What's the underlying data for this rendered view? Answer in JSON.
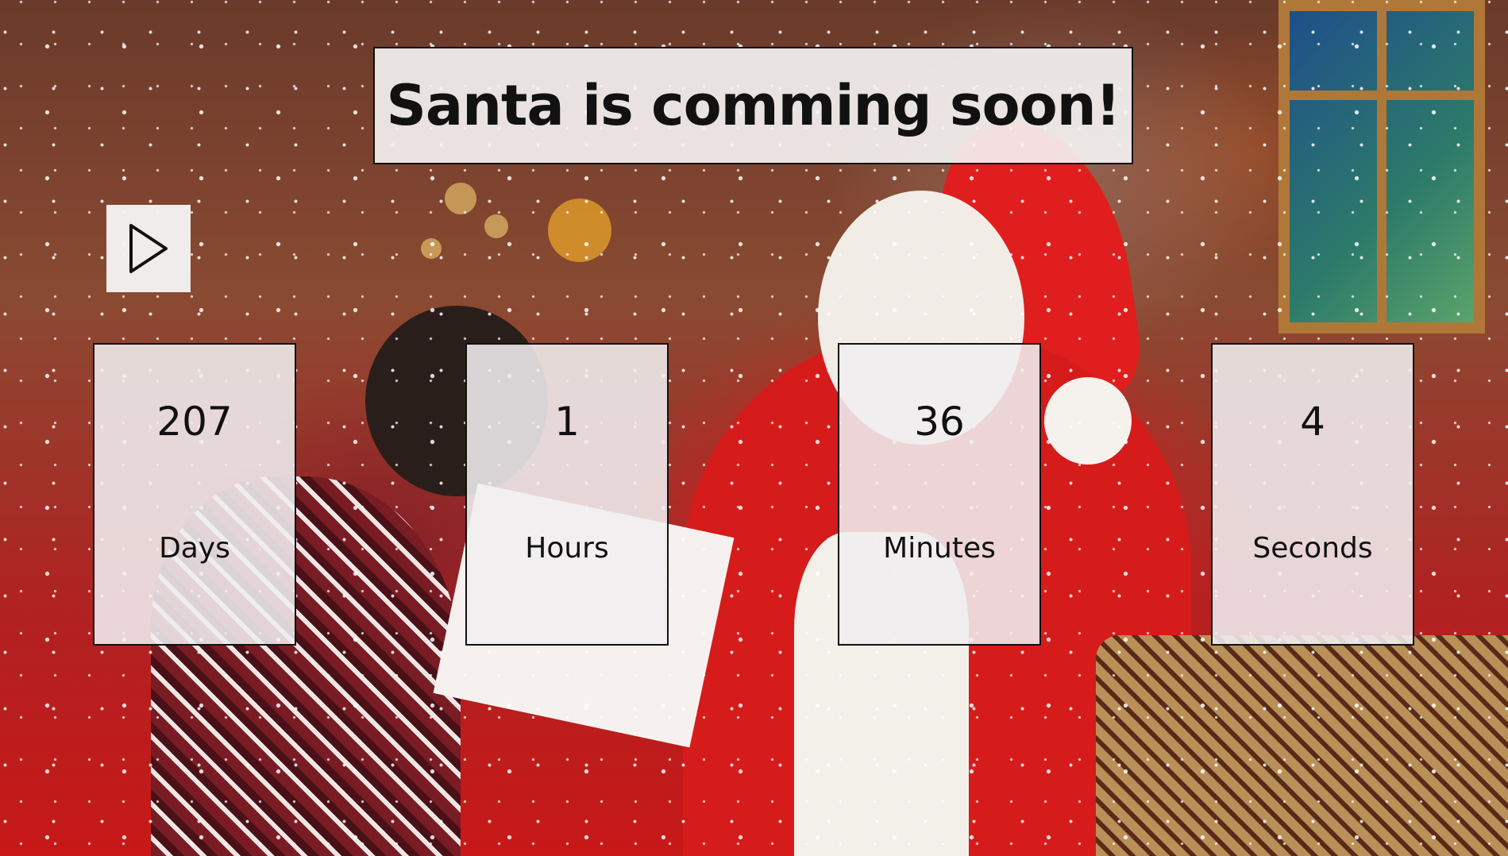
{
  "title": "Santa is comming soon!",
  "play_button": {
    "icon": "play-icon"
  },
  "countdown": [
    {
      "value": "207",
      "label": "Days"
    },
    {
      "value": "1",
      "label": "Hours"
    },
    {
      "value": "36",
      "label": "Minutes"
    },
    {
      "value": "4",
      "label": "Seconds"
    }
  ]
}
